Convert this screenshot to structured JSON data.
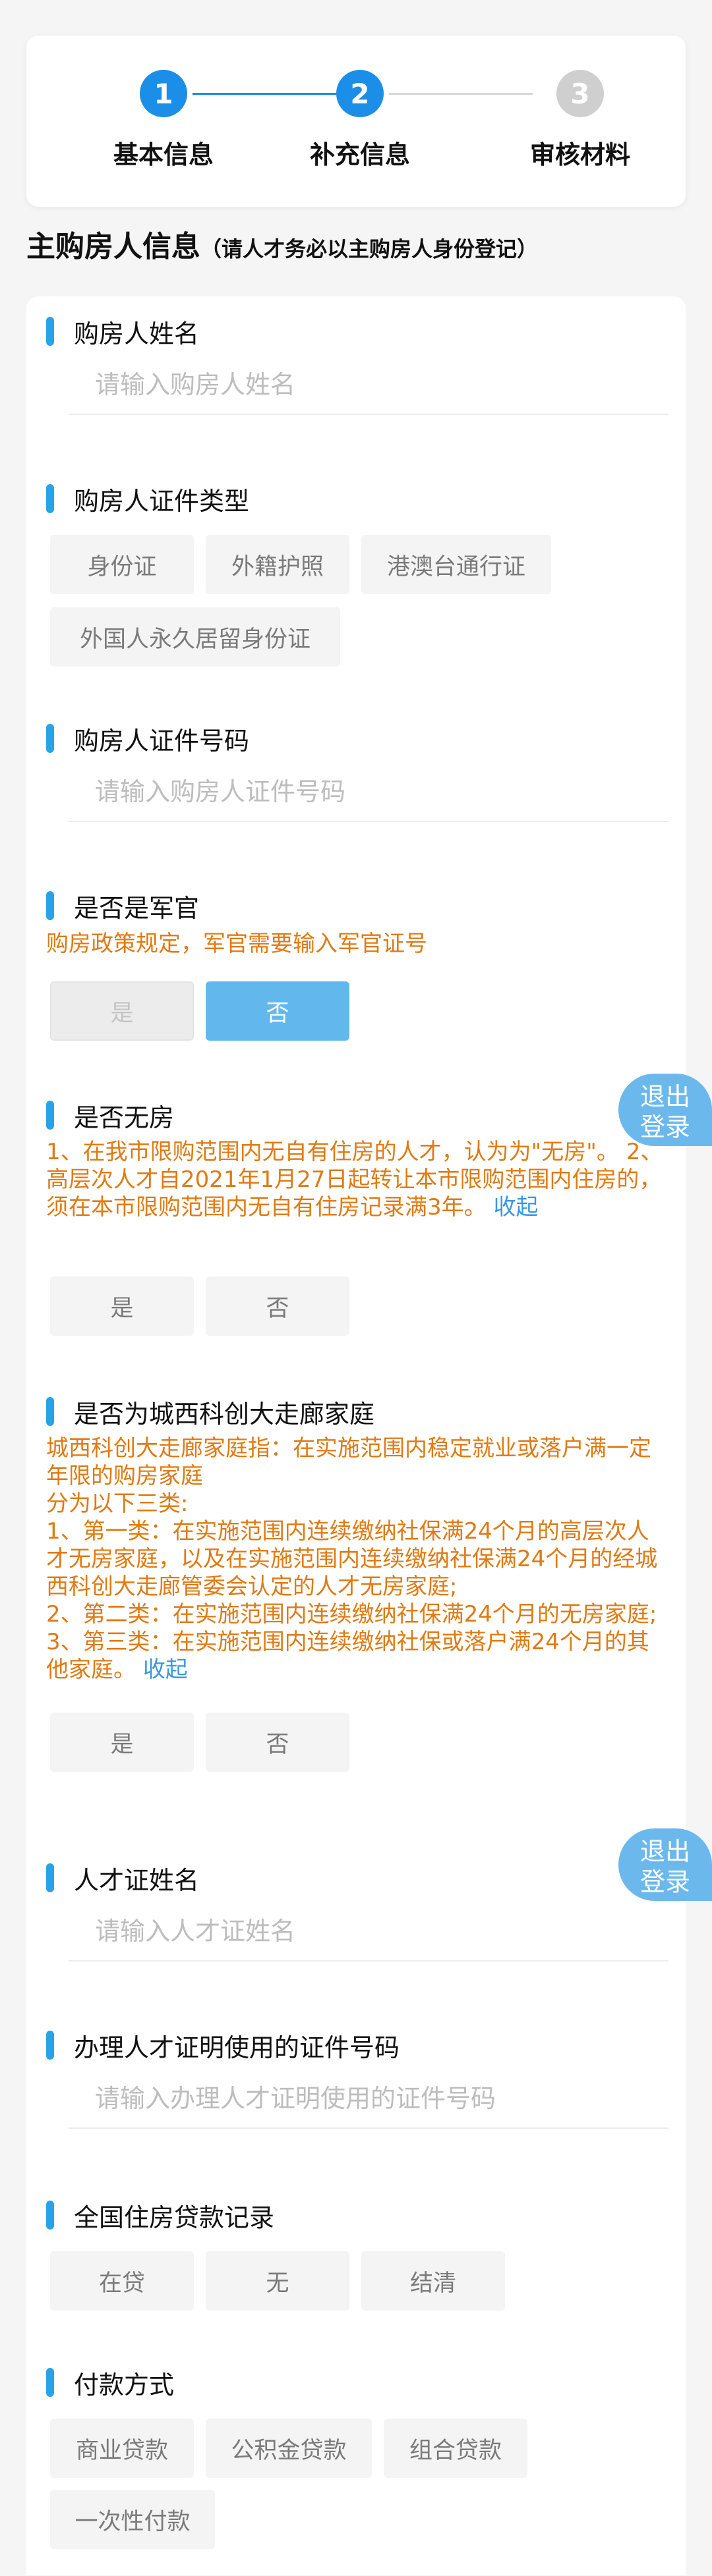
{
  "stepper": {
    "steps": [
      {
        "number": "1",
        "label": "基本信息",
        "state": "active"
      },
      {
        "number": "2",
        "label": "补充信息",
        "state": "active"
      },
      {
        "number": "3",
        "label": "审核材料",
        "state": "inactive"
      }
    ]
  },
  "section": {
    "title": "主购房人信息",
    "note": "（请人才务必以主购房人身份登记）"
  },
  "fields": {
    "buyer_name": {
      "label": "购房人姓名",
      "placeholder": "请输入购房人姓名"
    },
    "id_type": {
      "label": "购房人证件类型",
      "options": [
        "身份证",
        "外籍护照",
        "港澳台通行证",
        "外国人永久居留身份证"
      ]
    },
    "id_number": {
      "label": "购房人证件号码",
      "placeholder": "请输入购房人证件号码"
    },
    "military": {
      "label": "是否是军官",
      "hint": "购房政策规定，军官需要输入军官证号",
      "options": [
        "是",
        "否"
      ]
    },
    "no_house": {
      "label": "是否无房",
      "hint": "1、在我市限购范围内无自有住房的人才，认为为\"无房\"。 2、高层次人才自2021年1月27日起转让本市限购范围内住房的，须在本市限购范围内无自有住房记录满3年。",
      "collapse": "收起",
      "options": [
        "是",
        "否"
      ]
    },
    "corridor": {
      "label": "是否为城西科创大走廊家庭",
      "hint_lines": [
        "城西科创大走廊家庭指：在实施范围内稳定就业或落户满一定年限的购房家庭",
        "分为以下三类:",
        "1、第一类：在实施范围内连续缴纳社保满24个月的高层次人才无房家庭，以及在实施范围内连续缴纳社保满24个月的经城西科创大走廊管委会认定的人才无房家庭;",
        "2、第二类：在实施范围内连续缴纳社保满24个月的无房家庭;",
        "3、第三类：在实施范围内连续缴纳社保或落户满24个月的其他家庭。"
      ],
      "collapse": "收起",
      "options": [
        "是",
        "否"
      ]
    },
    "talent_name": {
      "label": "人才证姓名",
      "placeholder": "请输入人才证姓名"
    },
    "talent_id": {
      "label": "办理人才证明使用的证件号码",
      "placeholder": "请输入办理人才证明使用的证件号码"
    },
    "loan_record": {
      "label": "全国住房贷款记录",
      "options": [
        "在贷",
        "无",
        "结清"
      ]
    },
    "payment": {
      "label": "付款方式",
      "options": [
        "商业贷款",
        "公积金贷款",
        "组合贷款",
        "一次性付款"
      ]
    }
  },
  "logout": {
    "line1": "退出",
    "line2": "登录"
  },
  "colors": {
    "primary": "#1b8ee8",
    "accent_bar": "#29a3e6",
    "hint": "#e07a12",
    "selected_chip": "#62b8ed"
  }
}
